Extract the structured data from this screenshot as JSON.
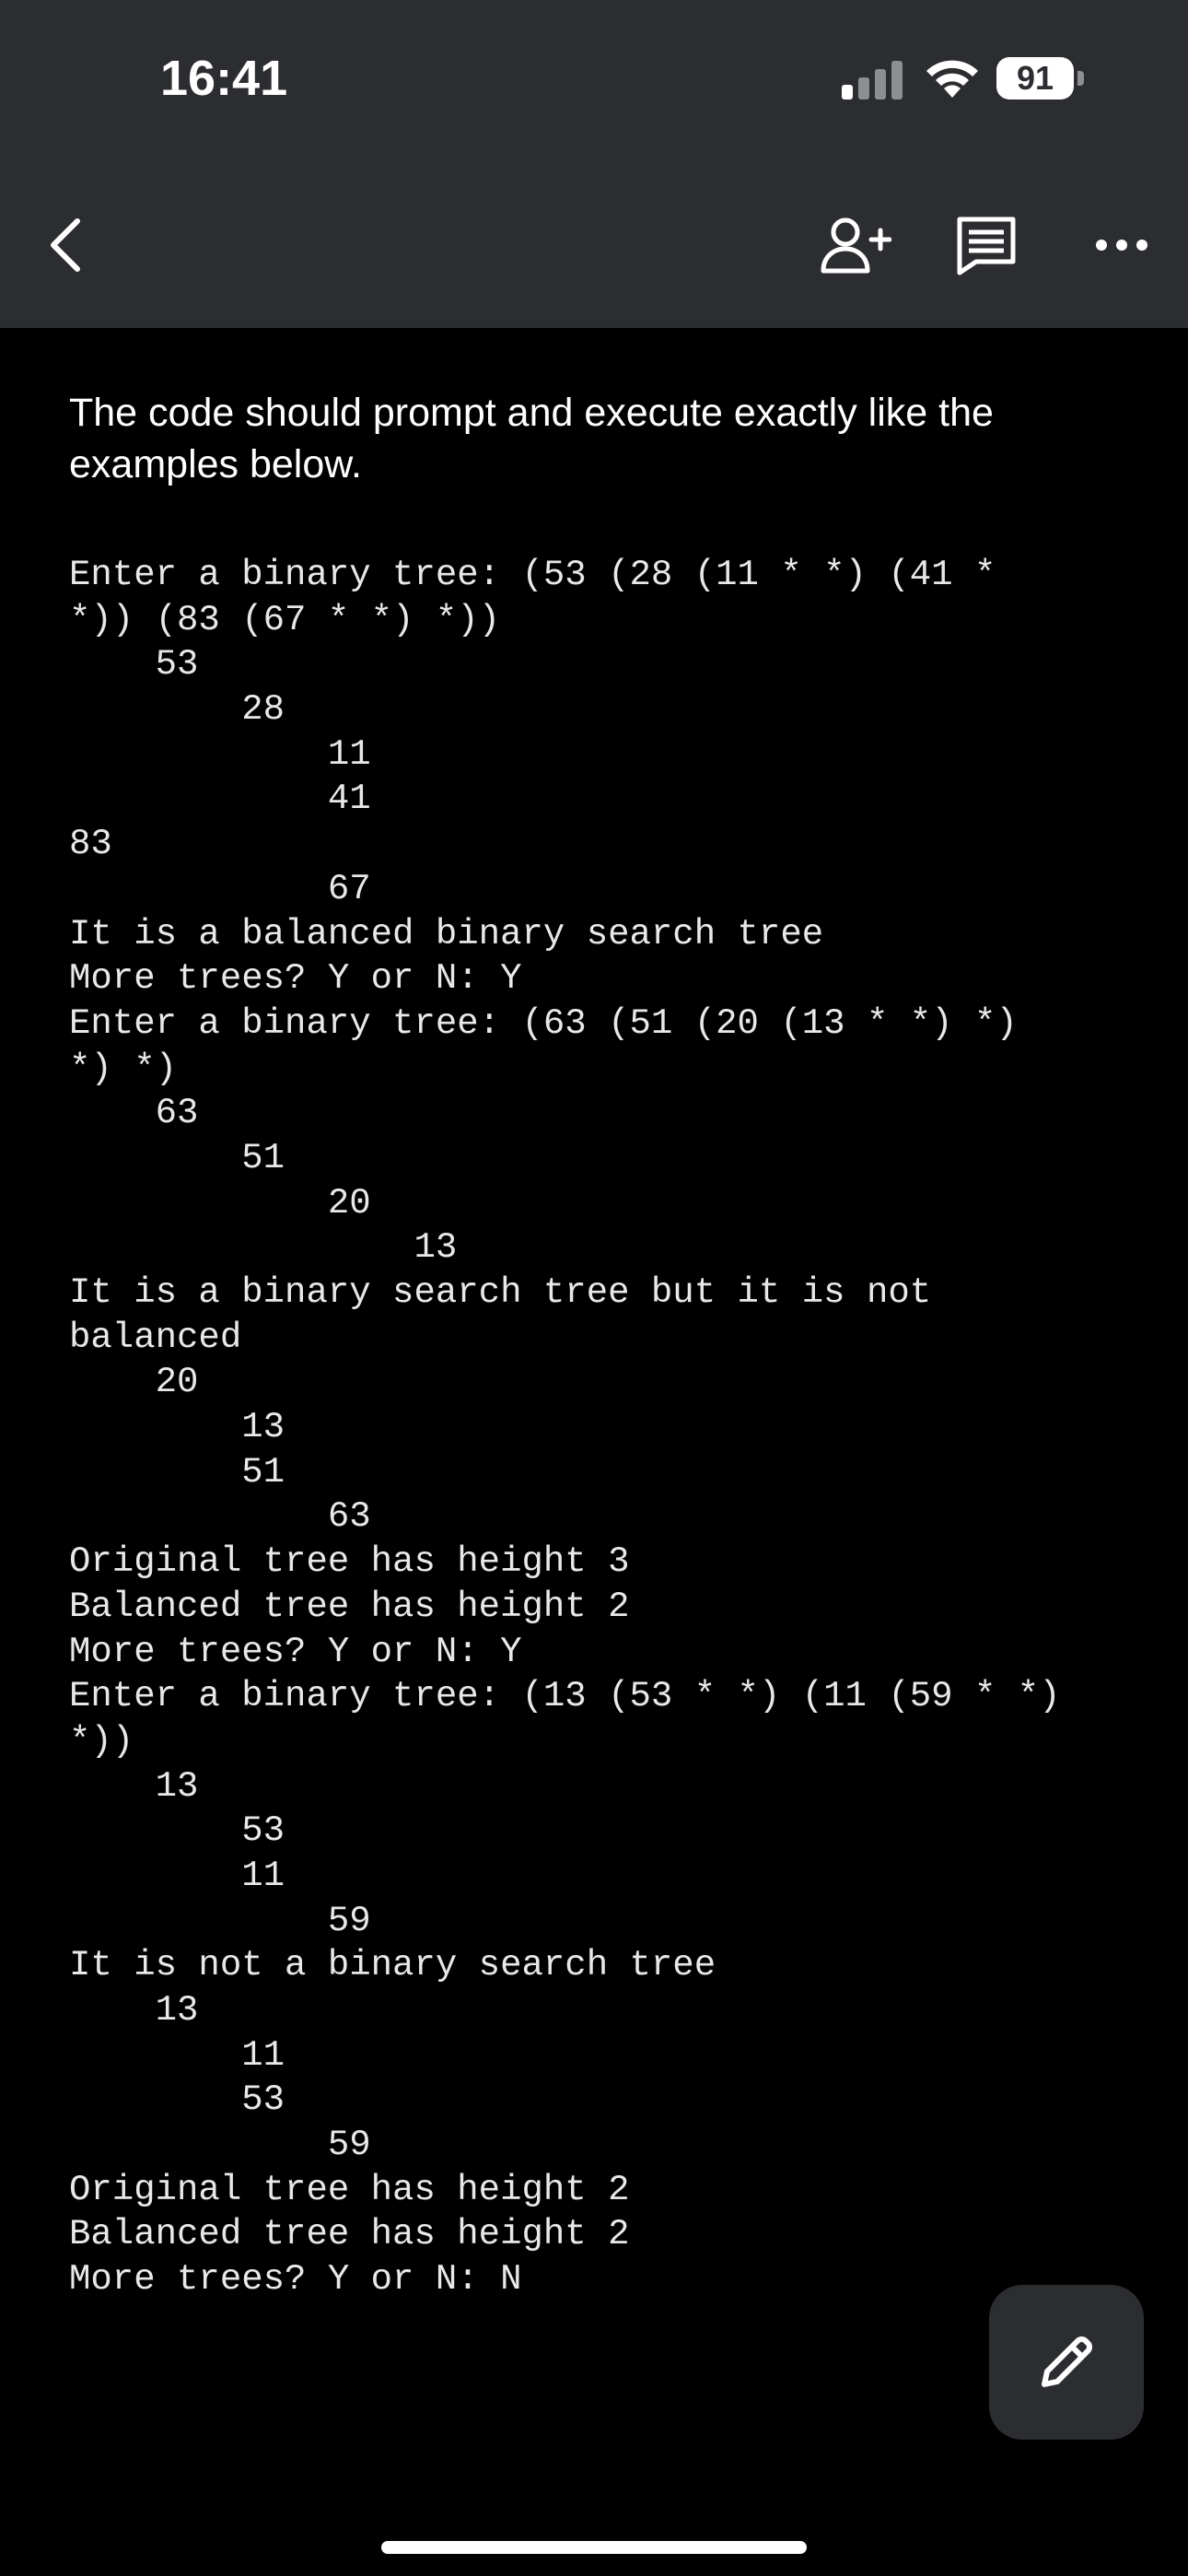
{
  "status_bar": {
    "time": "16:41",
    "battery": "91"
  },
  "toolbar": {
    "back_icon": "chevron-left-icon",
    "add_person_icon": "person-add-icon",
    "comment_icon": "comment-icon",
    "more_icon": "more-horizontal-icon"
  },
  "document": {
    "intro": "The code should prompt and execute exactly like the examples below.",
    "console_lines": [
      "Enter a binary tree: (53 (28 (11 * *) (41 *",
      "*)) (83 (67 * *) *))",
      "    53",
      "        28",
      "            11",
      "            41",
      "83",
      "            67",
      "It is a balanced binary search tree",
      "More trees? Y or N: Y",
      "Enter a binary tree: (63 (51 (20 (13 * *) *)",
      "*) *)",
      "    63",
      "        51",
      "            20",
      "                13",
      "It is a binary search tree but it is not",
      "balanced",
      "    20",
      "        13",
      "        51",
      "            63",
      "Original tree has height 3",
      "Balanced tree has height 2",
      "More trees? Y or N: Y",
      "Enter a binary tree: (13 (53 * *) (11 (59 * *)",
      "*))",
      "    13",
      "        53",
      "        11",
      "            59",
      "It is not a binary search tree",
      "    13",
      "        11",
      "        53",
      "            59",
      "Original tree has height 2",
      "Balanced tree has height 2",
      "More trees? Y or N: N"
    ]
  },
  "fab": {
    "icon": "pencil-edit-icon"
  },
  "colors": {
    "toolbar_bg": "#2c2d30",
    "page_bg": "#000000",
    "text": "#ffffff"
  }
}
